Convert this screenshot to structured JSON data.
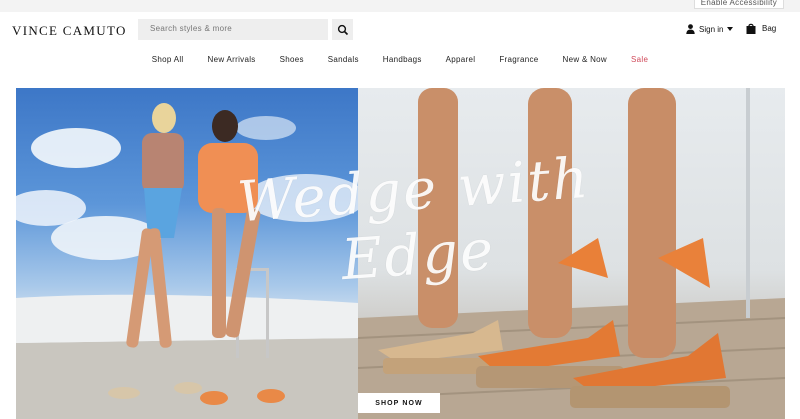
{
  "topbar": {
    "accessibility_link": "Enable Accessibility"
  },
  "header": {
    "logo": "VINCE CAMUTO",
    "search": {
      "placeholder": "Search styles & more"
    },
    "account": {
      "label": "Sign in"
    },
    "bag": {
      "label": "Bag"
    }
  },
  "nav": {
    "items": [
      {
        "label": "Shop All"
      },
      {
        "label": "New Arrivals"
      },
      {
        "label": "Shoes"
      },
      {
        "label": "Sandals"
      },
      {
        "label": "Handbags"
      },
      {
        "label": "Apparel"
      },
      {
        "label": "Fragrance"
      },
      {
        "label": "New & Now"
      },
      {
        "label": "Sale"
      }
    ]
  },
  "hero": {
    "script_title": "Wedge with Edge",
    "cta_label": "SHOP NOW"
  },
  "colors": {
    "sale": "#d04a5a",
    "sky": "#3d77c7"
  }
}
